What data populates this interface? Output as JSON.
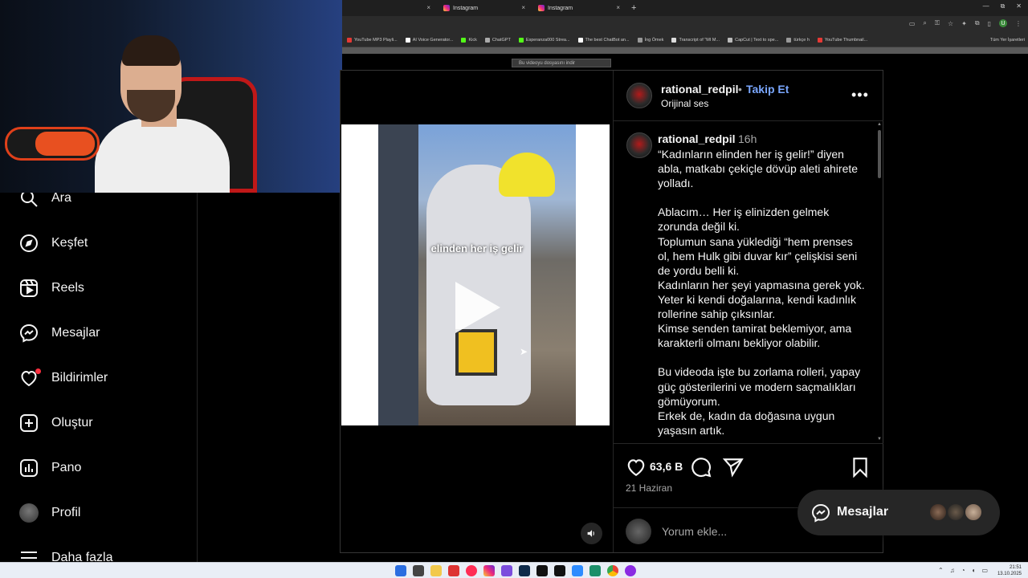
{
  "browser": {
    "tabs": [
      {
        "title": ""
      },
      {
        "title": "Instagram"
      },
      {
        "title": "Instagram"
      }
    ],
    "new_tab_symbol": "+",
    "close_symbol": "×",
    "window_controls": [
      "—",
      "⧉",
      "✕"
    ],
    "profile_initial": "U",
    "bookmarks": [
      "YouTube MP3 Playli...",
      "AI Voice Generator...",
      "Kick",
      "ChatGPT",
      "Esperanza000 Strea...",
      "The best ChatBot an...",
      "İng Ömek",
      "Transcript of \"MI M...",
      "CapCut | Text to spe...",
      "türkçe h",
      "YouTube Thumbnail..."
    ],
    "bookmarks_right": "Tüm Yer İşaretleri",
    "download_bar": "Bu videoyu dosyasını indir"
  },
  "sidebar": {
    "items": [
      {
        "label": "Ara",
        "icon": "search-icon"
      },
      {
        "label": "Keşfet",
        "icon": "compass-icon"
      },
      {
        "label": "Reels",
        "icon": "reels-icon"
      },
      {
        "label": "Mesajlar",
        "icon": "messenger-icon"
      },
      {
        "label": "Bildirimler",
        "icon": "heart-icon"
      },
      {
        "label": "Oluştur",
        "icon": "plus-square-icon"
      },
      {
        "label": "Pano",
        "icon": "dashboard-icon"
      },
      {
        "label": "Profil",
        "icon": "avatar"
      },
      {
        "label": "Daha fazla",
        "icon": "menu-icon"
      }
    ]
  },
  "post": {
    "username": "rational_redpil",
    "separator": "•",
    "follow_label": "Takip Et",
    "audio": "Orijinal ses",
    "caption_user": "rational_redpil",
    "caption_time": "16h",
    "caption_text": "“Kadınların elinden her iş gelir!” diyen abla, matkabı çekiçle dövüp aleti ahirete yolladı.\n\nAblacım… Her iş elinizden gelmek zorunda değil ki.\nToplumun sana yüklediği “hem prenses ol, hem Hulk gibi duvar kır” çelişkisi seni de yordu belli ki.\nKadınların her şeyi yapmasına gerek yok. Yeter ki kendi doğalarına, kendi kadınlık rollerine sahip çıksınlar.\nKimse senden tamirat beklemiyor, ama karakterli olmanı bekliyor olabilir.\n\nBu videoda işte bu zorlama rolleri, yapay güç gösterilerini ve modern saçmalıkları gömüyorum.\nErkek de, kadın da doğasına uygun yaşasın artık.",
    "video_overlay_text": "elinden her iş gelir",
    "likes": "63,6 B",
    "date": "21 Haziran",
    "comment_placeholder": "Yorum ekle..."
  },
  "messages_pill": {
    "label": "Mesajlar"
  },
  "taskbar": {
    "time": "21:51",
    "date": "13.10.2025"
  },
  "colors": {
    "follow": "#7aa7ff",
    "notification_dot": "#ff3040",
    "background": "#000000"
  }
}
